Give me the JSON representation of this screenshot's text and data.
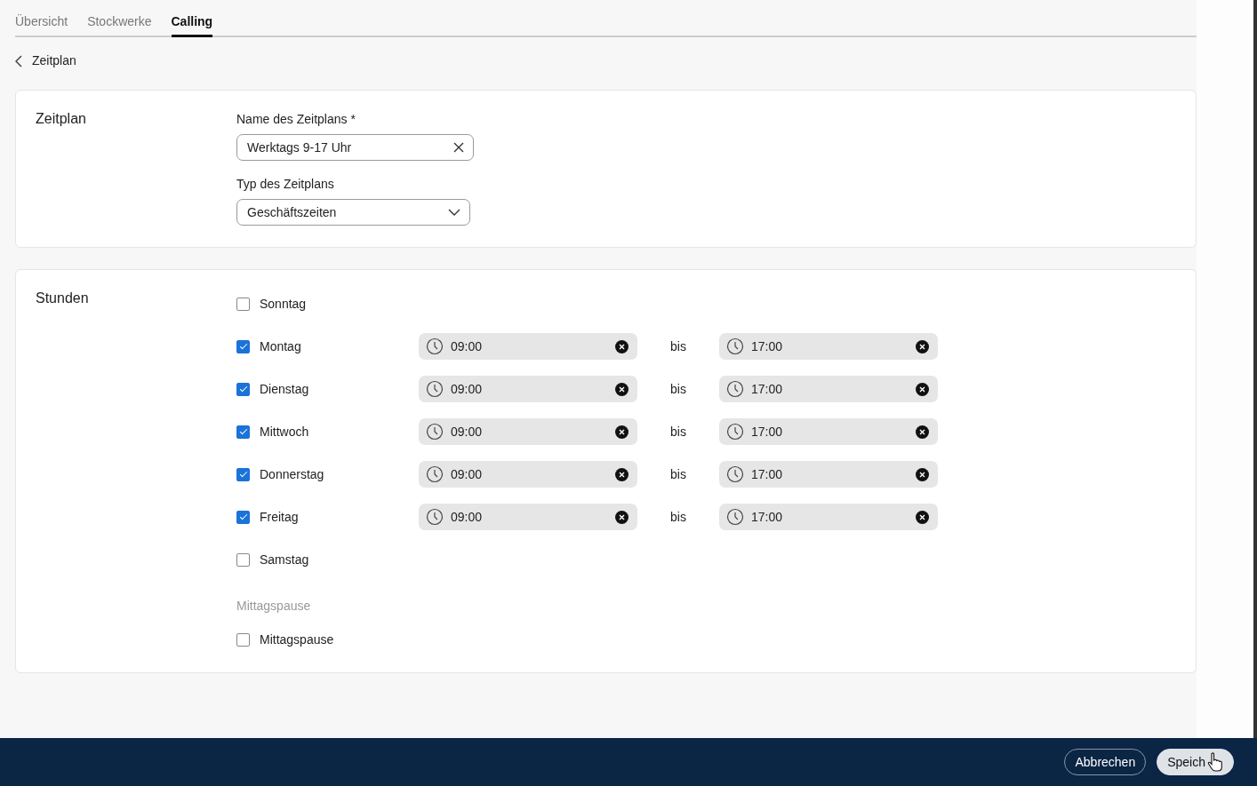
{
  "tabs": [
    {
      "label": "Übersicht",
      "selected": false
    },
    {
      "label": "Stockwerke",
      "selected": false
    },
    {
      "label": "Calling",
      "selected": true
    }
  ],
  "back_link": "Zeitplan",
  "schedule_card": {
    "title": "Zeitplan",
    "name_label": "Name des Zeitplans *",
    "name_value": "Werktags 9-17 Uhr",
    "type_label": "Typ des Zeitplans",
    "type_value": "Geschäftszeiten"
  },
  "hours_card": {
    "title": "Stunden",
    "days": [
      {
        "label": "Sonntag",
        "checked": false
      },
      {
        "label": "Montag",
        "checked": true,
        "from": "09:00",
        "separator": "bis",
        "to": "17:00"
      },
      {
        "label": "Dienstag",
        "checked": true,
        "from": "09:00",
        "separator": "bis",
        "to": "17:00"
      },
      {
        "label": "Mittwoch",
        "checked": true,
        "from": "09:00",
        "separator": "bis",
        "to": "17:00"
      },
      {
        "label": "Donnerstag",
        "checked": true,
        "from": "09:00",
        "separator": "bis",
        "to": "17:00"
      },
      {
        "label": "Freitag",
        "checked": true,
        "from": "09:00",
        "separator": "bis",
        "to": "17:00"
      },
      {
        "label": "Samstag",
        "checked": false
      }
    ],
    "break_heading": "Mittagspause",
    "break_option": {
      "label": "Mittagspause",
      "checked": false
    }
  },
  "footer": {
    "buttons": [
      {
        "label": "Abbrechen",
        "kind": "outline"
      },
      {
        "label": "Speich",
        "kind": "filled"
      }
    ]
  }
}
